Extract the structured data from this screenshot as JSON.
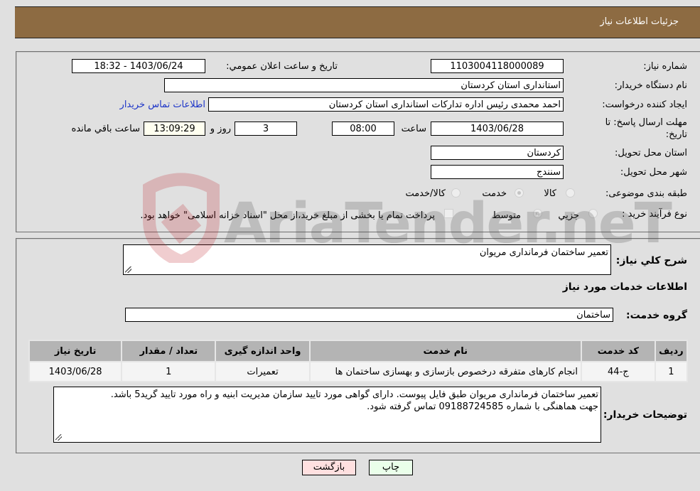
{
  "header": {
    "title": "جزئیات اطلاعات نیاز"
  },
  "details": {
    "need_number": {
      "label": "شماره نیاز:",
      "value": "1103004118000089"
    },
    "announce_datetime": {
      "label": "تاریخ و ساعت اعلان عمومي:",
      "value": "1403/06/24 - 18:32"
    },
    "buyer_org": {
      "label": "نام دستگاه خریدار:",
      "value": "استانداری استان کردستان"
    },
    "requester": {
      "label": "ایجاد کننده درخواست:",
      "value": "احمد محمدی رئیس اداره تدارکات استانداری استان کردستان"
    },
    "buyer_contact_link": "اطلاعات تماس خریدار",
    "deadline": {
      "label_line1": "مهلت ارسال پاسخ: تا",
      "label_line2": "تاریخ:",
      "date": "1403/06/28",
      "time_label": "ساعت",
      "time": "08:00",
      "days": "3",
      "days_label": "روز و",
      "remaining": "13:09:29",
      "remaining_label": "ساعت باقي مانده"
    },
    "delivery_province": {
      "label": "استان محل تحویل:",
      "value": "کردستان"
    },
    "delivery_city": {
      "label": "شهر محل تحویل:",
      "value": "سنندج"
    },
    "category": {
      "label": "طبقه بندی موضوعی:",
      "options": [
        "کالا",
        "خدمت",
        "کالا/خدمت"
      ],
      "selected": "خدمت"
    },
    "purchase_process": {
      "label": "نوع فرآیند خرید :",
      "options": [
        "جزيي",
        "متوسط"
      ],
      "selected": "متوسط",
      "treasury_note": "پرداخت تمام یا بخشی از مبلغ خرید،از محل \"اسناد خزانه اسلامی\" خواهد بود."
    }
  },
  "summary": {
    "label": "شرح کلي نیاز:",
    "value": "تعمیر ساختمان فرمانداری مریوان"
  },
  "services": {
    "section_title": "اطلاعات خدمات مورد نیاز",
    "group_label": "گروه خدمت:",
    "group_value": "ساختمان",
    "columns": [
      "ردیف",
      "کد خدمت",
      "نام خدمت",
      "واحد اندازه گیری",
      "تعداد / مقدار",
      "تاریخ نیاز"
    ],
    "rows": [
      [
        "1",
        "ج-44",
        "انجام کارهای متفرقه درخصوص بازسازی و بهسازی ساختمان ها",
        "تعمیرات",
        "1",
        "1403/06/28"
      ]
    ]
  },
  "buyer_notes": {
    "label": "توضیحات خریدار:",
    "line1": "تعمیر ساختمان فرمانداری مریوان طبق فایل پیوست. دارای گواهی مورد تایید سازمان مدیریت ابنیه و راه مورد تایید گرید5 باشد.",
    "line2": "جهت هماهنگی با شماره 09188724585 تماس گرفته شود."
  },
  "buttons": {
    "print": "چاپ",
    "back": "بازگشت"
  },
  "watermark": {
    "text": "AriaTender.neT"
  },
  "colors": {
    "header_bg": "#8d6b42",
    "print_bg": "#eaffea",
    "back_bg": "#ffe0e0",
    "link": "#1d35c8"
  }
}
